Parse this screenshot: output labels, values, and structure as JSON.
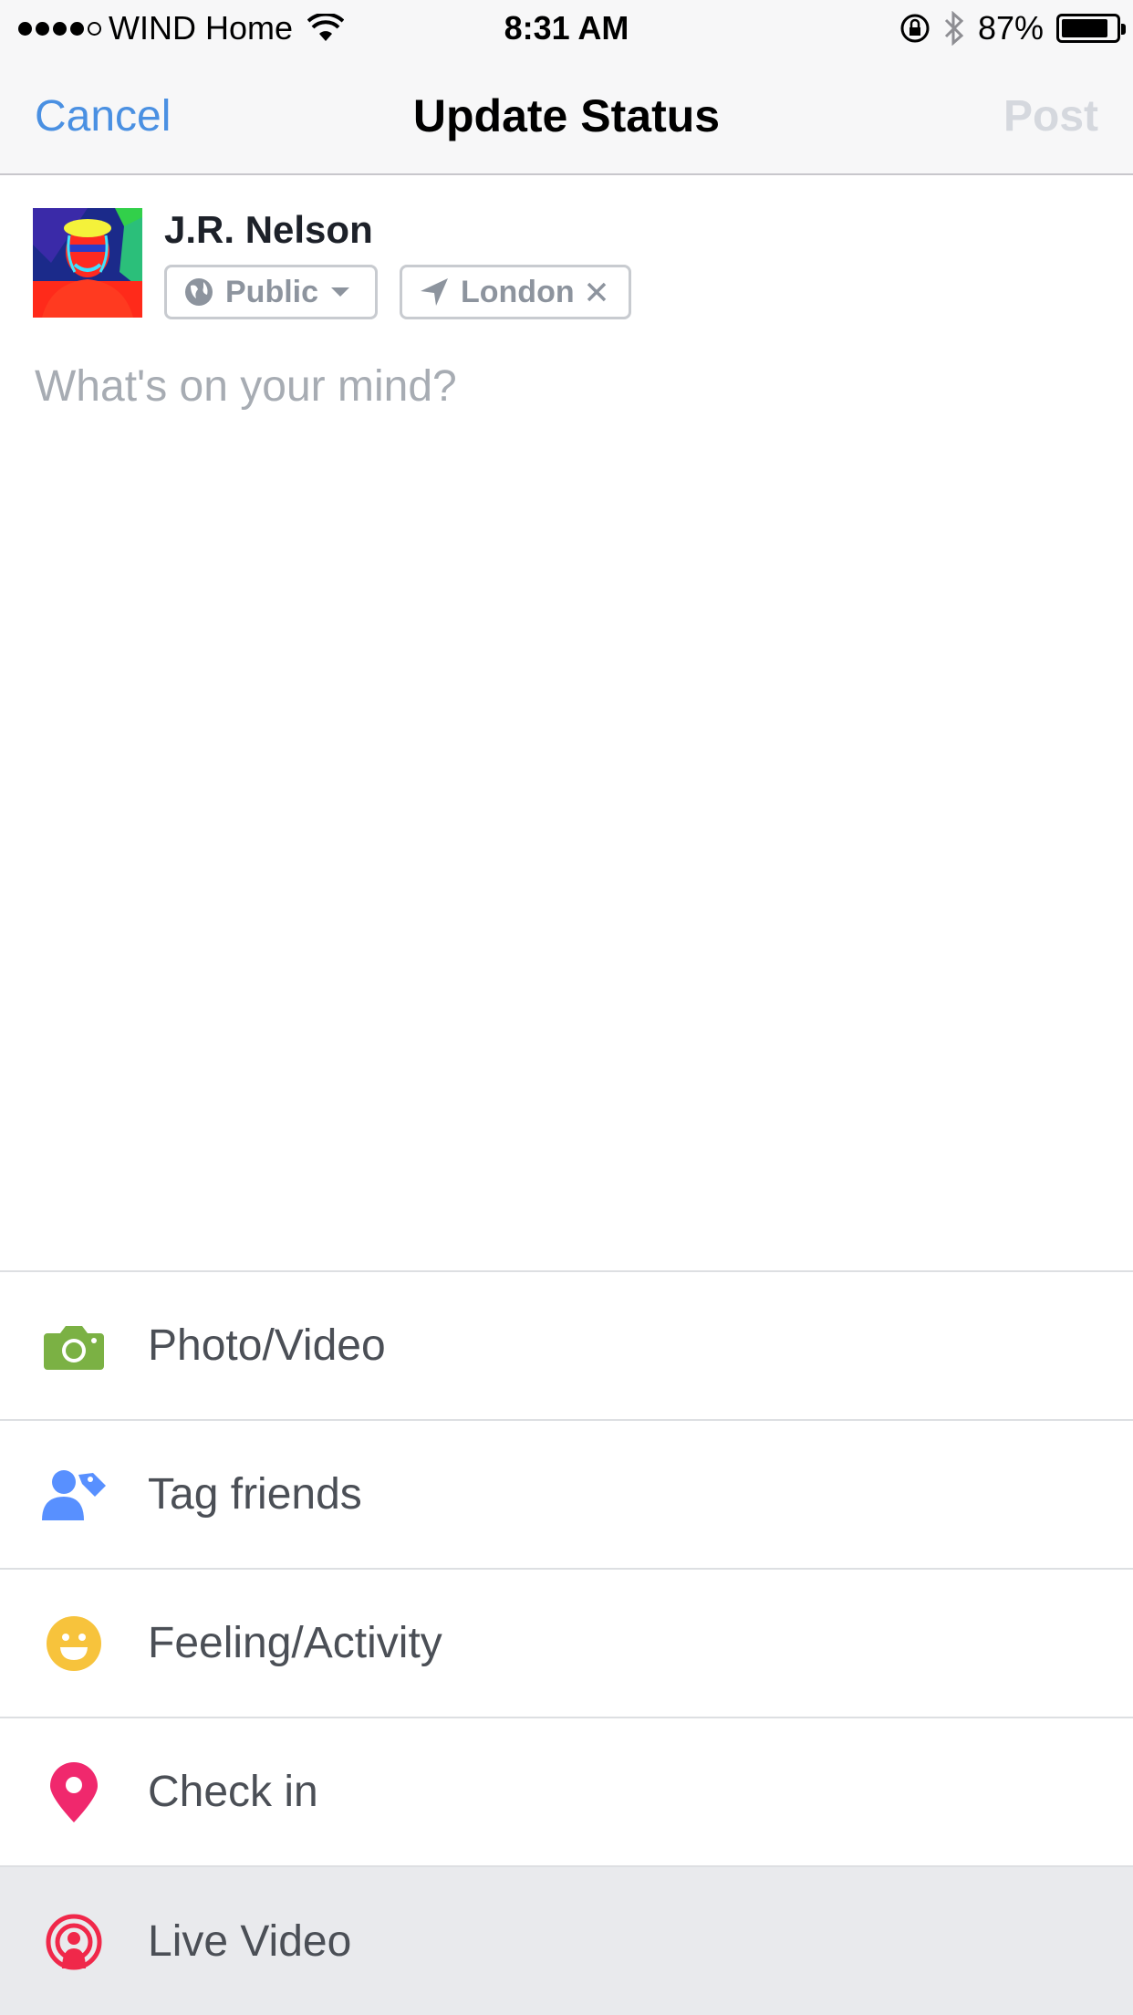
{
  "status_bar": {
    "carrier": "WIND Home",
    "time": "8:31 AM",
    "battery": "87%",
    "battery_level": 0.87
  },
  "nav": {
    "cancel": "Cancel",
    "title": "Update Status",
    "post": "Post"
  },
  "user": {
    "name": "J.R. Nelson",
    "audience": "Public",
    "location": "London"
  },
  "composer": {
    "placeholder": "What's on your mind?"
  },
  "actions": [
    {
      "label": "Photo/Video",
      "icon": "camera-icon",
      "color": "#7bb144"
    },
    {
      "label": "Tag friends",
      "icon": "tag-friends-icon",
      "color": "#5890ff"
    },
    {
      "label": "Feeling/Activity",
      "icon": "smiley-icon",
      "color": "#f7c33c"
    },
    {
      "label": "Check in",
      "icon": "location-pin-icon",
      "color": "#f0286d"
    },
    {
      "label": "Live Video",
      "icon": "live-video-icon",
      "color": "#f0284a"
    }
  ],
  "colors": {
    "accent": "#4a90e2",
    "post_disabled": "#d5d8de",
    "highlight_row": "#e9eaed"
  }
}
